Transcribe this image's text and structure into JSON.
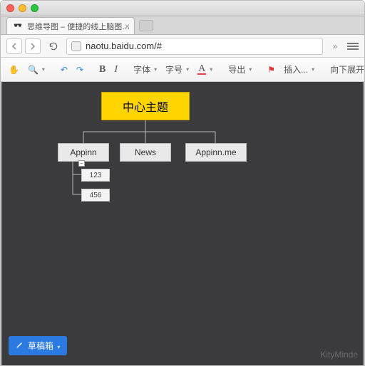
{
  "browser": {
    "tab_title": "思维导图 – 便捷的线上脑图…",
    "url": "naotu.baidu.com/#"
  },
  "toolbar": {
    "font_family_label": "字体",
    "font_size_label": "字号",
    "export_label": "导出",
    "insert_label": "插入...",
    "expand_label": "向下展开"
  },
  "mindmap": {
    "root": "中心主题",
    "children": [
      {
        "label": "Appinn"
      },
      {
        "label": "News"
      },
      {
        "label": "Appinn.me"
      }
    ],
    "sub": [
      {
        "label": "123"
      },
      {
        "label": "456"
      }
    ]
  },
  "footer": {
    "draft_label": "草稿箱",
    "brand": "KityMinde"
  }
}
